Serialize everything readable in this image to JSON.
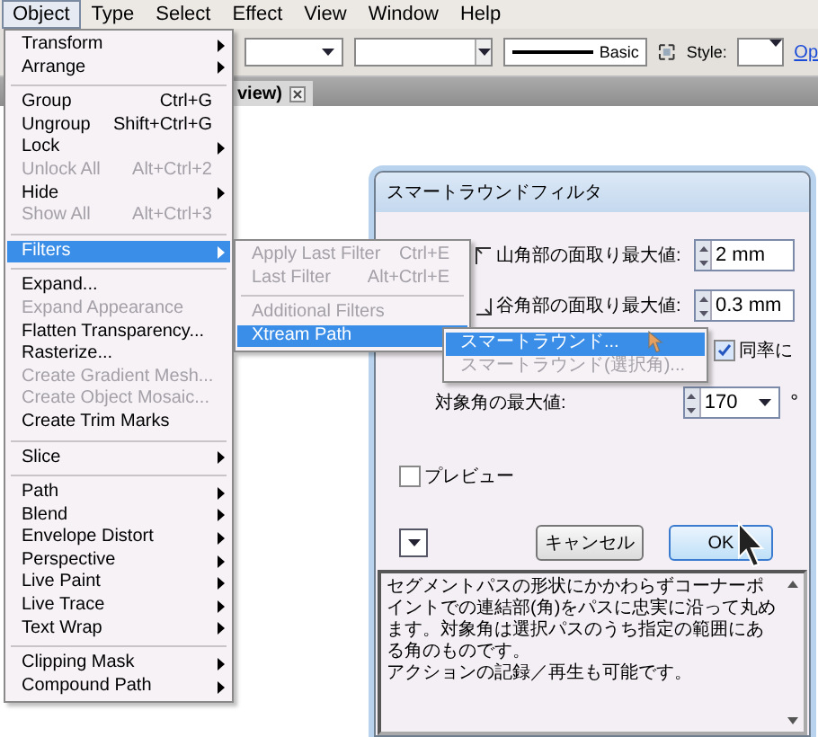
{
  "menubar": [
    {
      "label": "Object",
      "selected": true
    },
    {
      "label": "Type",
      "selected": false
    },
    {
      "label": "Select",
      "selected": false
    },
    {
      "label": "Effect",
      "selected": false
    },
    {
      "label": "View",
      "selected": false
    },
    {
      "label": "Window",
      "selected": false
    },
    {
      "label": "Help",
      "selected": false
    }
  ],
  "toolbar": {
    "stroke_label": "Basic",
    "style_label": "Style:",
    "link": "Op"
  },
  "document_tab": {
    "label": "view)"
  },
  "object_menu": {
    "items": [
      {
        "kind": "item",
        "label": "Transform",
        "submenu": true,
        "disabled": false,
        "selected": false
      },
      {
        "kind": "item",
        "label": "Arrange",
        "submenu": true,
        "disabled": false,
        "selected": false
      },
      {
        "kind": "separator"
      },
      {
        "kind": "item",
        "label": "Group",
        "shortcut": "Ctrl+G",
        "submenu": false,
        "disabled": false,
        "selected": false
      },
      {
        "kind": "item",
        "label": "Ungroup",
        "shortcut": "Shift+Ctrl+G",
        "submenu": false,
        "disabled": false,
        "selected": false
      },
      {
        "kind": "item",
        "label": "Lock",
        "submenu": true,
        "disabled": false,
        "selected": false
      },
      {
        "kind": "item",
        "label": "Unlock All",
        "shortcut": "Alt+Ctrl+2",
        "submenu": false,
        "disabled": true,
        "selected": false
      },
      {
        "kind": "item",
        "label": "Hide",
        "submenu": true,
        "disabled": false,
        "selected": false
      },
      {
        "kind": "item",
        "label": "Show All",
        "shortcut": "Alt+Ctrl+3",
        "submenu": false,
        "disabled": true,
        "selected": false
      },
      {
        "kind": "separator"
      },
      {
        "kind": "item",
        "label": "Filters",
        "submenu": true,
        "disabled": false,
        "selected": true
      },
      {
        "kind": "separator"
      },
      {
        "kind": "item",
        "label": "Expand...",
        "submenu": false,
        "disabled": false,
        "selected": false
      },
      {
        "kind": "item",
        "label": "Expand Appearance",
        "submenu": false,
        "disabled": true,
        "selected": false
      },
      {
        "kind": "item",
        "label": "Flatten Transparency...",
        "submenu": false,
        "disabled": false,
        "selected": false
      },
      {
        "kind": "item",
        "label": "Rasterize...",
        "submenu": false,
        "disabled": false,
        "selected": false
      },
      {
        "kind": "item",
        "label": "Create Gradient Mesh...",
        "submenu": false,
        "disabled": true,
        "selected": false
      },
      {
        "kind": "item",
        "label": "Create Object Mosaic...",
        "submenu": false,
        "disabled": true,
        "selected": false
      },
      {
        "kind": "item",
        "label": "Create Trim Marks",
        "submenu": false,
        "disabled": false,
        "selected": false
      },
      {
        "kind": "separator"
      },
      {
        "kind": "item",
        "label": "Slice",
        "submenu": true,
        "disabled": false,
        "selected": false
      },
      {
        "kind": "separator"
      },
      {
        "kind": "item",
        "label": "Path",
        "submenu": true,
        "disabled": false,
        "selected": false
      },
      {
        "kind": "item",
        "label": "Blend",
        "submenu": true,
        "disabled": false,
        "selected": false
      },
      {
        "kind": "item",
        "label": "Envelope Distort",
        "submenu": true,
        "disabled": false,
        "selected": false
      },
      {
        "kind": "item",
        "label": "Perspective",
        "submenu": true,
        "disabled": false,
        "selected": false
      },
      {
        "kind": "item",
        "label": "Live Paint",
        "submenu": true,
        "disabled": false,
        "selected": false
      },
      {
        "kind": "item",
        "label": "Live Trace",
        "submenu": true,
        "disabled": false,
        "selected": false
      },
      {
        "kind": "item",
        "label": "Text Wrap",
        "submenu": true,
        "disabled": false,
        "selected": false
      },
      {
        "kind": "separator"
      },
      {
        "kind": "item",
        "label": "Clipping Mask",
        "submenu": true,
        "disabled": false,
        "selected": false
      },
      {
        "kind": "item",
        "label": "Compound Path",
        "submenu": true,
        "disabled": false,
        "selected": false
      }
    ]
  },
  "filters_submenu": {
    "items": [
      {
        "kind": "item",
        "label": "Apply Last Filter",
        "shortcut": "Ctrl+E",
        "submenu": false,
        "disabled": true,
        "selected": false
      },
      {
        "kind": "item",
        "label": "Last Filter",
        "shortcut": "Alt+Ctrl+E",
        "submenu": false,
        "disabled": true,
        "selected": false
      },
      {
        "kind": "separator"
      },
      {
        "kind": "item",
        "label": "Additional Filters",
        "submenu": false,
        "disabled": true,
        "selected": false
      },
      {
        "kind": "item",
        "label": "Xtream Path",
        "submenu": true,
        "disabled": false,
        "selected": true
      }
    ]
  },
  "xtream_submenu": {
    "items": [
      {
        "kind": "item",
        "label": "スマートラウンド...",
        "submenu": false,
        "disabled": false,
        "selected": true
      },
      {
        "kind": "item",
        "label": "スマートラウンド(選択角)...",
        "submenu": false,
        "disabled": true,
        "selected": false
      }
    ]
  },
  "dialog": {
    "title": "スマートラウンドフィルタ",
    "fields": [
      {
        "kind": "peak",
        "label": "山角部の面取り最大値:",
        "value": "2 mm"
      },
      {
        "kind": "valley",
        "label": "谷角部の面取り最大値:",
        "value": "0.3 mm"
      }
    ],
    "same_ratio": {
      "label": "同率に",
      "checked": true
    },
    "max_angle": {
      "label": "対象角の最大値:",
      "value": "170",
      "unit": "°"
    },
    "preview": {
      "label": "プレビュー",
      "checked": false
    },
    "cancel": "キャンセル",
    "ok": "OK",
    "description": [
      "セグメントパスの形状にかかわらずコーナーポイントでの連結部(角)をパスに忠実に沿って丸めます。対象角は選択パスのうち指定の範囲にある角のものです。",
      "アクションの記録／再生も可能です。"
    ]
  }
}
